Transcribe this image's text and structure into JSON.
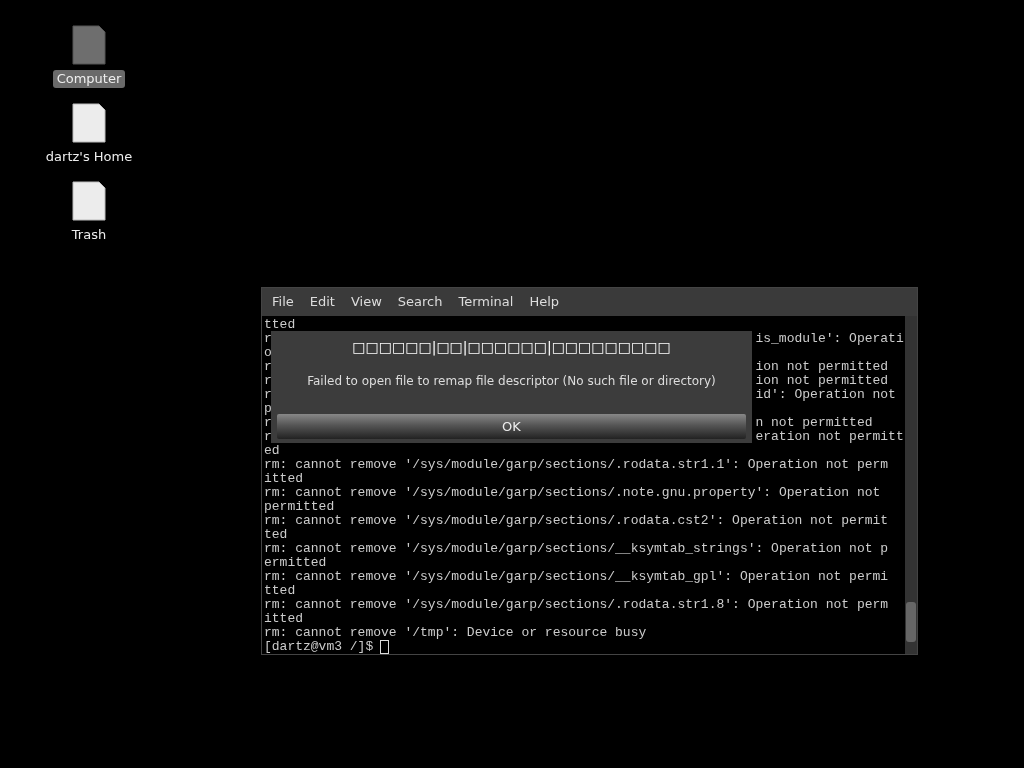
{
  "desktop_icons": [
    {
      "label": "Computer",
      "selected": true
    },
    {
      "label": "dartz's Home",
      "selected": false
    },
    {
      "label": "Trash",
      "selected": false
    }
  ],
  "terminal": {
    "menu": [
      "File",
      "Edit",
      "View",
      "Search",
      "Terminal",
      "Help"
    ],
    "lines": [
      {
        "kind": "full",
        "text": "tted"
      },
      {
        "kind": "split",
        "left": "r",
        "right": "is_module': Operati"
      },
      {
        "kind": "split",
        "left": "o"
      },
      {
        "kind": "split",
        "left": "r",
        "right": "ion not permitted"
      },
      {
        "kind": "split",
        "left": "r",
        "right": "ion not permitted"
      },
      {
        "kind": "split",
        "left": "r",
        "right": "id': Operation not"
      },
      {
        "kind": "split",
        "left": "p"
      },
      {
        "kind": "split",
        "left": "r",
        "right": "n not permitted"
      },
      {
        "kind": "split",
        "left": "r",
        "right": "eration not permitt"
      },
      {
        "kind": "full",
        "text": "ed"
      },
      {
        "kind": "full",
        "text": "rm: cannot remove '/sys/module/garp/sections/.rodata.str1.1': Operation not perm"
      },
      {
        "kind": "full",
        "text": "itted"
      },
      {
        "kind": "full",
        "text": "rm: cannot remove '/sys/module/garp/sections/.note.gnu.property': Operation not"
      },
      {
        "kind": "full",
        "text": "permitted"
      },
      {
        "kind": "full",
        "text": "rm: cannot remove '/sys/module/garp/sections/.rodata.cst2': Operation not permit"
      },
      {
        "kind": "full",
        "text": "ted"
      },
      {
        "kind": "full",
        "text": "rm: cannot remove '/sys/module/garp/sections/__ksymtab_strings': Operation not p"
      },
      {
        "kind": "full",
        "text": "ermitted"
      },
      {
        "kind": "full",
        "text": "rm: cannot remove '/sys/module/garp/sections/__ksymtab_gpl': Operation not permi"
      },
      {
        "kind": "full",
        "text": "tted"
      },
      {
        "kind": "full",
        "text": "rm: cannot remove '/sys/module/garp/sections/.rodata.str1.8': Operation not perm"
      },
      {
        "kind": "full",
        "text": "itted"
      },
      {
        "kind": "full",
        "text": "rm: cannot remove '/tmp': Device or resource busy"
      }
    ],
    "prompt": "[dartz@vm3 /]$"
  },
  "dialog": {
    "title": "□□□□□□|□□|□□□□□□|□□□□□□□□□",
    "message": "Failed to open file to remap file descriptor (No such file or directory)",
    "button": "OK"
  }
}
